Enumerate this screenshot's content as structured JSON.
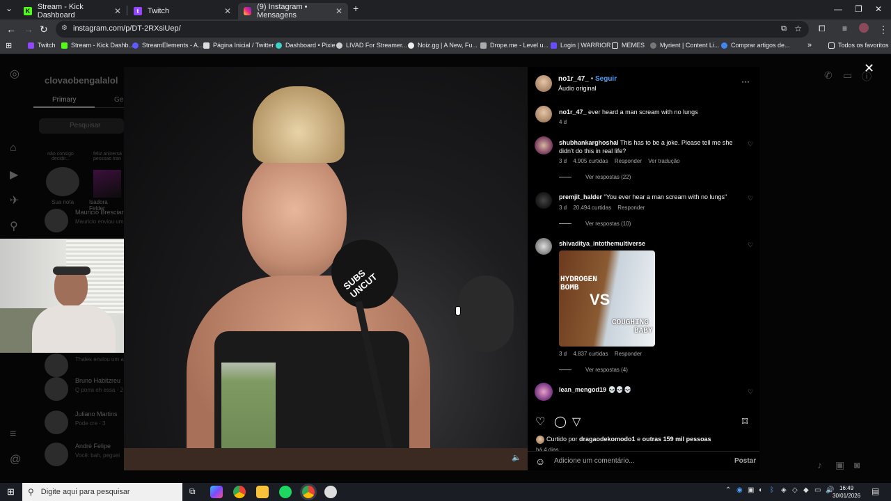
{
  "tabs": [
    {
      "title": "Stream - Kick Dashboard",
      "active": false
    },
    {
      "title": "Twitch",
      "active": false
    },
    {
      "title": "(9) Instagram • Mensagens",
      "active": true
    }
  ],
  "address": {
    "url": "instagram.com/p/DT-2RXsiUep/"
  },
  "bookmarks": [
    "Twitch",
    "Stream - Kick Dashb...",
    "StreamElements - A...",
    "Página Inicial / Twitter",
    "Dashboard • Pixie",
    "LIVAD For Streamer...",
    "Noiz.gg | A New, Fu...",
    "Drope.me - Level u...",
    "Login | WARRIOR",
    "MEMES",
    "Myrient | Content Li...",
    "Comprar artigos de..."
  ],
  "bookmarks_all": "Todos os favoritos",
  "dm": {
    "username": "clovaobengalalol",
    "tab_primary": "Primary",
    "tab_general": "Ger",
    "search_placeholder": "Pesquisar",
    "note_label": "Sua nota",
    "note_bubble": "não consigo decidir...",
    "note_bubble2": "feliz aniversá pessoas tran",
    "note_user2": "Isadora Felder",
    "rows": [
      {
        "name": "Mauricio Bresciar",
        "preview": "Mauricio enviou um"
      },
      {
        "name": "",
        "preview": "Thales enviou um a"
      },
      {
        "name": "Bruno Habitzreu",
        "preview": "Q porra eh essa · 2"
      },
      {
        "name": "Juliano Martins",
        "preview": "Pode cre · 3"
      },
      {
        "name": "André Felipe",
        "preview": "Você: bah, peguei"
      }
    ]
  },
  "post": {
    "author": "no1r_47_",
    "follow": "Seguir",
    "audio": "Áudio original",
    "caption": "ever heard a man scream with no lungs",
    "caption_time": "4 d",
    "mic_text": "SUBS UNCUT",
    "comments": [
      {
        "user": "shubhankarghoshal",
        "text": "This has to be a joke. Please tell me she didn't do this in real life?",
        "time": "3 d",
        "likes": "4.905 curtidas",
        "reply": "Responder",
        "translate": "Ver tradução",
        "replies": "Ver respostas (22)"
      },
      {
        "user": "premjit_halder",
        "text": "\"You ever hear a man scream with no lungs\"",
        "time": "3 d",
        "likes": "20.494 curtidas",
        "reply": "Responder",
        "replies": "Ver respostas (10)"
      },
      {
        "user": "shivaditya_intothemultiverse",
        "text": "",
        "image_text": [
          "HYDROGEN",
          "BOMB",
          "VS",
          "COUGHING",
          "BABY"
        ],
        "time": "3 d",
        "likes": "4.837 curtidas",
        "reply": "Responder",
        "replies": "Ver respostas (4)"
      },
      {
        "user": "lean_mengod19",
        "text": "💀💀💀"
      }
    ],
    "liked_by_prefix": "Curtido por",
    "liked_by_user": "dragaodekomodo1",
    "liked_by_suffix": "e",
    "liked_by_others": "outras 159 mil pessoas",
    "time_ago": "há 4 dias",
    "comment_placeholder": "Adicione um comentário...",
    "post_button": "Postar"
  },
  "taskbar": {
    "search_placeholder": "Digite aqui para pesquisar",
    "time": "16:49",
    "date": "30/01/2026"
  }
}
